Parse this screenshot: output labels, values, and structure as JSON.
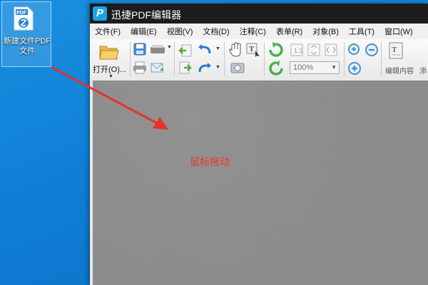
{
  "desktop": {
    "icon_badge": "PDF",
    "icon_label_line1": "新建文件PDF",
    "icon_label_line2": "文件"
  },
  "window": {
    "logo_letter": "P",
    "title": "迅捷PDF编辑器"
  },
  "menu": {
    "items": [
      "文件(F)",
      "编辑(E)",
      "视图(V)",
      "文档(D)",
      "注释(C)",
      "表单(R)",
      "对象(B)",
      "工具(T)",
      "窗口(W)"
    ]
  },
  "toolbar": {
    "open_label": "打开(O)...",
    "zoom_value": "100%",
    "edit_content_label": "编辑内容",
    "add_label": "添"
  },
  "canvas": {
    "annotation_text": "鼠标拖动"
  },
  "colors": {
    "desktop": "#0f7fd6",
    "annotation": "#e63a2f",
    "titlebar": "#1c1c1c",
    "logo": "#1aa4e8"
  }
}
